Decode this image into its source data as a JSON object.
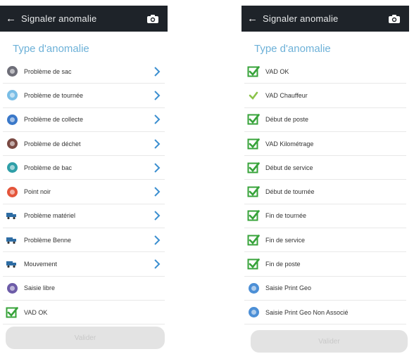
{
  "left": {
    "header": {
      "title": "Signaler anomalie",
      "back_icon": "arrow-left-icon",
      "camera_icon": "camera-icon"
    },
    "section_title": "Type d'anomalie",
    "items": [
      {
        "label": "Problème de sac",
        "icon": "circle-gray",
        "color": "#6e6e78",
        "chevron": true
      },
      {
        "label": "Problème de tournée",
        "icon": "circle-lightblue",
        "color": "#79bde6",
        "chevron": true
      },
      {
        "label": "Problème de collecte",
        "icon": "circle-blue",
        "color": "#3a78c9",
        "chevron": true
      },
      {
        "label": "Problème de déchet",
        "icon": "circle-brown",
        "color": "#7a4a43",
        "chevron": true
      },
      {
        "label": "Problème de bac",
        "icon": "circle-teal",
        "color": "#2f9fa8",
        "chevron": true
      },
      {
        "label": "Point noir",
        "icon": "circle-red",
        "color": "#e4553b",
        "chevron": true
      },
      {
        "label": "Problème matériel",
        "icon": "truck-icon",
        "color": "#2e6da4",
        "chevron": true
      },
      {
        "label": "Problème Benne",
        "icon": "truck-icon",
        "color": "#2e6da4",
        "chevron": true
      },
      {
        "label": "Mouvement",
        "icon": "truck-icon",
        "color": "#2e6da4",
        "chevron": true
      },
      {
        "label": "Saisie libre",
        "icon": "circle-purple",
        "color": "#6d5ca8",
        "chevron": false
      },
      {
        "label": "VAD OK",
        "icon": "checkbox-checked-icon",
        "color": "#37a33a",
        "chevron": false
      }
    ],
    "button_label": "Valider"
  },
  "right": {
    "header": {
      "title": "Signaler anomalie",
      "back_icon": "arrow-left-icon",
      "camera_icon": "camera-icon"
    },
    "section_title": "Type d'anomalie",
    "items": [
      {
        "label": "VAD OK",
        "icon": "checkbox-checked-icon",
        "color": "#37a33a"
      },
      {
        "label": "VAD Chauffeur",
        "icon": "checkmark-icon",
        "color": "#8bc34a"
      },
      {
        "label": "Début de poste",
        "icon": "checkbox-checked-icon",
        "color": "#37a33a"
      },
      {
        "label": "VAD Kilométrage",
        "icon": "checkbox-checked-icon",
        "color": "#37a33a"
      },
      {
        "label": "Début de service",
        "icon": "checkbox-checked-icon",
        "color": "#37a33a"
      },
      {
        "label": "Début de tournée",
        "icon": "checkbox-checked-icon",
        "color": "#37a33a"
      },
      {
        "label": "Fin de tournée",
        "icon": "checkbox-checked-icon",
        "color": "#37a33a"
      },
      {
        "label": "Fin de service",
        "icon": "checkbox-checked-icon",
        "color": "#37a33a"
      },
      {
        "label": "Fin de poste",
        "icon": "checkbox-checked-icon",
        "color": "#37a33a"
      },
      {
        "label": "Saisie Print Geo",
        "icon": "circle-blue",
        "color": "#4c8fd6"
      },
      {
        "label": "Saisie Print Geo Non Associé",
        "icon": "circle-blue",
        "color": "#4c8fd6"
      }
    ],
    "button_label": "Valider"
  },
  "colors": {
    "header_bg": "#1e2329",
    "section_title": "#6db1d8",
    "chevron": "#3c8fd0",
    "button_bg": "#e3e3e3"
  }
}
